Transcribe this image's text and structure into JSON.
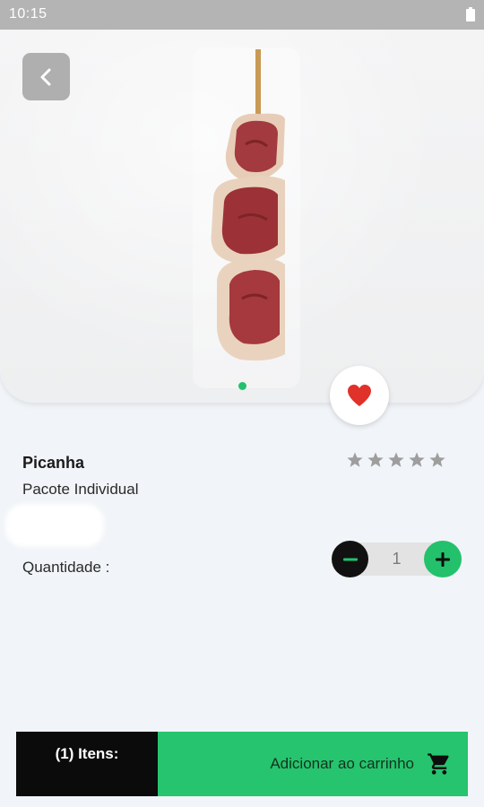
{
  "status_bar": {
    "time": "10:15"
  },
  "product": {
    "name": "Picanha",
    "subtitle": "Pacote Individual",
    "rating_stars": 5,
    "rating_filled": 0,
    "image_icon": "picanha-skewer-photo"
  },
  "navigation": {
    "back_icon": "chevron-left-icon"
  },
  "favorite": {
    "icon": "heart-icon",
    "active": true
  },
  "carousel": {
    "pages": 1,
    "current": 1
  },
  "quantity": {
    "label": "Quantidade :",
    "value": "1"
  },
  "cart_bar": {
    "items_label": "(1) Itens:",
    "add_label": "Adicionar ao carrinho",
    "cart_icon": "cart-icon"
  },
  "colors": {
    "accent_green": "#26c46e",
    "favorite_red": "#e0312b",
    "star_gray": "#9e9e9e",
    "status_bar": "#b4b4b4"
  }
}
